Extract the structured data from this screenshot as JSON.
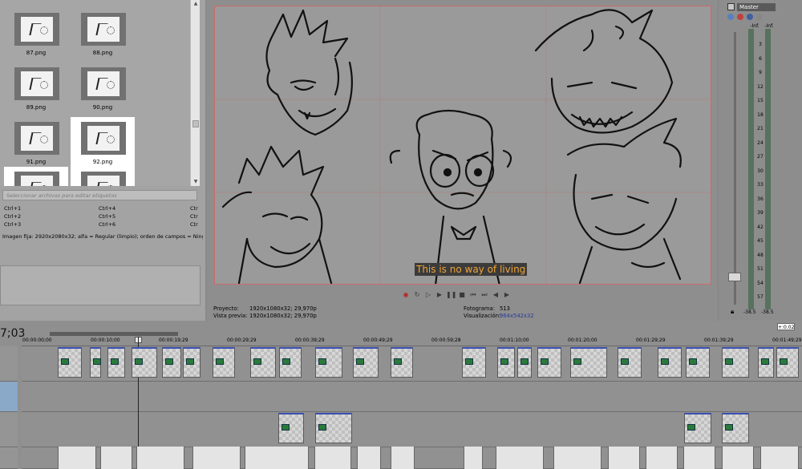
{
  "explorer": {
    "thumbnails": [
      {
        "name": "87.png",
        "selected": false
      },
      {
        "name": "88.png",
        "selected": false
      },
      {
        "name": "89.png",
        "selected": false
      },
      {
        "name": "90.png",
        "selected": false
      },
      {
        "name": "91.png",
        "selected": false
      },
      {
        "name": "92.png",
        "selected": true
      },
      {
        "name": "",
        "selected": true
      },
      {
        "name": "",
        "selected": true
      }
    ],
    "tag_placeholder": "Seleccionar archivos para editar etiquetas",
    "shortcuts": [
      "Ctrl+1",
      "Ctrl+2",
      "Ctrl+3",
      "Ctrl+4",
      "Ctrl+5",
      "Ctrl+6",
      "Ctr",
      "Ctr",
      "Ctr"
    ],
    "clip_info": "Imagen fija: 2920x2080x32; alfa = Regular (limpio); orden de campos = Ninguno"
  },
  "preview": {
    "subtitle": "This is no way of living",
    "project_label": "Proyecto:",
    "project_value": "1920x1080x32; 29,970p",
    "preview_label": "Vista previa:",
    "preview_value": "1920x1080x32; 29,970p",
    "frame_label": "Fotograma:",
    "frame_value": "513",
    "display_label": "Visualización:",
    "display_value": "964x542x32"
  },
  "transport": {
    "icons": [
      "record-icon",
      "loop-icon",
      "play-from-start-icon",
      "play-icon",
      "pause-icon",
      "stop-icon",
      "go-to-start-icon",
      "go-to-end-icon",
      "previous-frame-icon",
      "next-frame-icon"
    ]
  },
  "master": {
    "title": "Master",
    "meter_left_top": "-Inf.",
    "meter_right_top": "-Inf.",
    "scale": [
      "3",
      "6",
      "9",
      "12",
      "15",
      "18",
      "21",
      "24",
      "27",
      "30",
      "33",
      "36",
      "39",
      "42",
      "45",
      "48",
      "51",
      "54",
      "57"
    ],
    "level_left": "-38.5",
    "level_right": "-38.5"
  },
  "timeline": {
    "timecode": "7;03",
    "zoom_indicator": "+:0.02",
    "ruler_labels": [
      "00:00:00;00",
      "00:00:10;00",
      "00:00:19;29",
      "00:00:29;29",
      "00:00:39;29",
      "00:00:49;29",
      "00:00:59;28",
      "00:01:10;00",
      "00:01:20;00",
      "00:01:29;29",
      "00:01:39;29",
      "00:01:49;29"
    ]
  }
}
